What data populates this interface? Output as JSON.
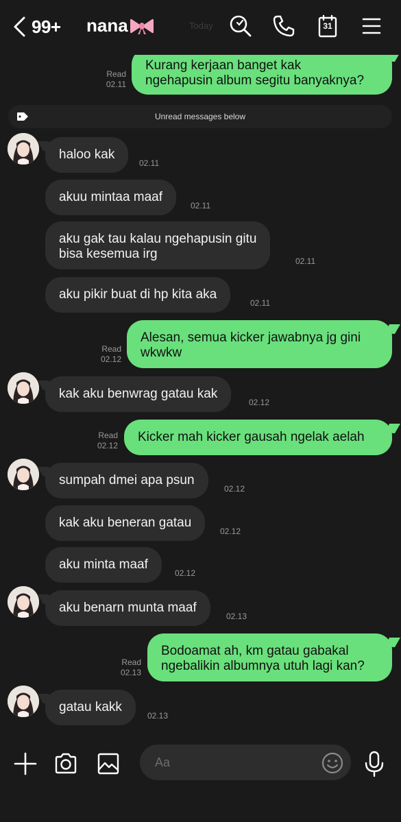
{
  "header": {
    "unread_count": "99+",
    "contact_name": "nana",
    "date_label": "Today",
    "calendar_day": "31",
    "icons": [
      "chevron-left-icon",
      "search-icon",
      "phone-icon",
      "calendar-icon",
      "menu-icon"
    ]
  },
  "divider": {
    "label": "Unread messages below",
    "icon": "tag-icon"
  },
  "messages": [
    {
      "dir": "out",
      "lines": [
        "Kurang kerjaan banget kak",
        "ngehapusin album segitu banyaknya?"
      ],
      "status": "Read",
      "time": "02.11"
    },
    {
      "dir": "in",
      "lines": [
        "haloo kak"
      ],
      "time": "02.11"
    },
    {
      "dir": "in",
      "lines": [
        "akuu mintaa maaf"
      ],
      "time": "02.11"
    },
    {
      "dir": "in",
      "lines": [
        "aku gak tau kalau ngehapusin gitu",
        "bisa kesemua irg"
      ],
      "time": "02.11"
    },
    {
      "dir": "in",
      "lines": [
        "aku pikir buat di hp kita aka"
      ],
      "time": "02.11"
    },
    {
      "dir": "out",
      "lines": [
        "Alesan, semua kicker jawabnya jg gini",
        "wkwkw"
      ],
      "status": "Read",
      "time": "02.12"
    },
    {
      "dir": "in",
      "lines": [
        "kak aku benwrag gatau kak"
      ],
      "time": "02.12"
    },
    {
      "dir": "out",
      "lines": [
        "Kicker mah kicker gausah ngelak aelah"
      ],
      "status": "Read",
      "time": "02.12"
    },
    {
      "dir": "in",
      "lines": [
        "sumpah dmei apa psun"
      ],
      "time": "02.12"
    },
    {
      "dir": "in",
      "lines": [
        "kak aku beneran gatau"
      ],
      "time": "02.12"
    },
    {
      "dir": "in",
      "lines": [
        "aku minta maaf"
      ],
      "time": "02.12"
    },
    {
      "dir": "in",
      "lines": [
        "aku benarn munta maaf"
      ],
      "time": "02.13"
    },
    {
      "dir": "out",
      "lines": [
        "Bodoamat ah, km gatau gabakal",
        "ngebalikin albumnya utuh lagi kan?"
      ],
      "status": "Read",
      "time": "02.13"
    },
    {
      "dir": "in",
      "lines": [
        "gatau kakk"
      ],
      "time": "02.13"
    }
  ],
  "composer": {
    "placeholder": "Aa",
    "value": "",
    "icons": [
      "plus-icon",
      "camera-icon",
      "image-icon",
      "emoji-icon",
      "microphone-icon"
    ]
  },
  "colors": {
    "background": "#1a1a1a",
    "incoming_bubble": "#2d2d2d",
    "outgoing_bubble": "#69e07c",
    "timestamp": "#9a9a9a"
  }
}
